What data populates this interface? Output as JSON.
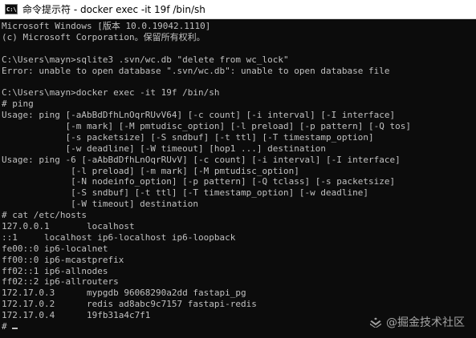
{
  "window": {
    "title": "命令提示符 - docker  exec -it 19f /bin/sh",
    "icon_label": "C:\\"
  },
  "console": {
    "lines": [
      "Microsoft Windows [版本 10.0.19042.1110]",
      "(c) Microsoft Corporation。保留所有权利。",
      "",
      "C:\\Users\\mayn>sqlite3 .svn/wc.db \"delete from wc_lock\"",
      "Error: unable to open database \".svn/wc.db\": unable to open database file",
      "",
      "C:\\Users\\mayn>docker exec -it 19f /bin/sh",
      "# ping",
      "Usage: ping [-aAbBdDfhLnOqrRUvV64] [-c count] [-i interval] [-I interface]",
      "            [-m mark] [-M pmtudisc_option] [-l preload] [-p pattern] [-Q tos]",
      "            [-s packetsize] [-S sndbuf] [-t ttl] [-T timestamp_option]",
      "            [-w deadline] [-W timeout] [hop1 ...] destination",
      "Usage: ping -6 [-aAbBdDfhLnOqrRUvV] [-c count] [-i interval] [-I interface]",
      "             [-l preload] [-m mark] [-M pmtudisc_option]",
      "             [-N nodeinfo_option] [-p pattern] [-Q tclass] [-s packetsize]",
      "             [-S sndbuf] [-t ttl] [-T timestamp_option] [-w deadline]",
      "             [-W timeout] destination",
      "# cat /etc/hosts",
      "127.0.0.1       localhost",
      "::1     localhost ip6-localhost ip6-loopback",
      "fe00::0 ip6-localnet",
      "ff00::0 ip6-mcastprefix",
      "ff02::1 ip6-allnodes",
      "ff02::2 ip6-allrouters",
      "172.17.0.3      mypgdb 96068290a2dd fastapi_pg",
      "172.17.0.2      redis ad8abc9c7157 fastapi-redis",
      "172.17.0.4      19fb31a4c7f1"
    ],
    "prompt": "# "
  },
  "watermark": {
    "text": "@掘金技术社区",
    "icon": "juejin-logo-icon"
  },
  "colors": {
    "background": "#0c0c0c",
    "foreground": "#c0c0c0",
    "titlebar": "#ffffff"
  }
}
